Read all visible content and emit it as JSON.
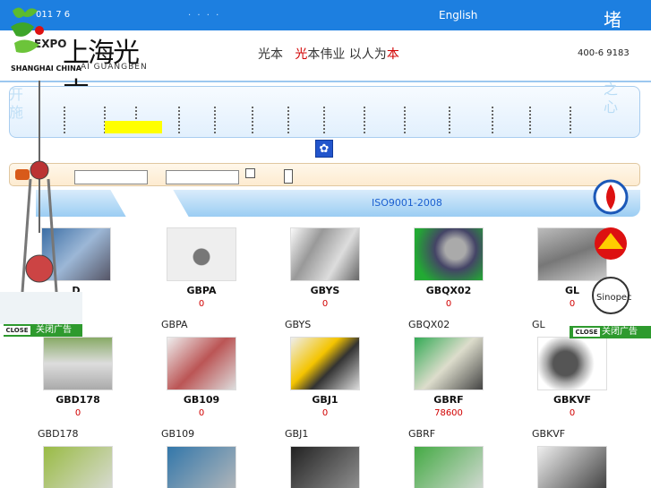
{
  "topbar": {
    "date": "011 7 6",
    "dots": "· · · ·",
    "english": "English",
    "right_char": "堵"
  },
  "header": {
    "logo": {
      "expo": "EXPO",
      "cn": "上海光本",
      "en": "AI GUANGBEN",
      "sh": "SHANGHAI CHINA"
    },
    "slogan_a": "光本",
    "slogan_b": "光",
    "slogan_c": "本伟业  以人为",
    "slogan_d": "本",
    "phone": "400-6  9183"
  },
  "section": {
    "iso": "ISO9001-2008"
  },
  "left_ad": {
    "vertical_text": "开 施",
    "close_btn": "CLOSE",
    "close_label": "关闭广告"
  },
  "right_ad": {
    "vertical_text": "之 心",
    "close_btn": "CLOSE",
    "close_label": "关闭广告"
  },
  "products": [
    {
      "code": "D",
      "price": "",
      "sub": ""
    },
    {
      "code": "GBPA",
      "price": "0",
      "sub": "GBPA"
    },
    {
      "code": "GBYS",
      "price": "0",
      "sub": "GBYS"
    },
    {
      "code": "GBQX02",
      "price": "0",
      "sub": "GBQX02"
    },
    {
      "code": "GL",
      "price": "0",
      "sub": "GL"
    },
    {
      "code": "GBD178",
      "price": "0",
      "sub": "GBD178"
    },
    {
      "code": "GB109",
      "price": "0",
      "sub": "GB109"
    },
    {
      "code": "GBJ1",
      "price": "0",
      "sub": "GBJ1"
    },
    {
      "code": "GBRF",
      "price": "78600",
      "sub": "GBRF"
    },
    {
      "code": "GBKVF",
      "price": "0",
      "sub": "GBKVF"
    }
  ],
  "colors": {
    "brand_blue": "#1d7fe0",
    "price_red": "#d10000",
    "ad_green": "#2e9a2e",
    "highlight": "#ffff00"
  },
  "icons": {
    "paw": "paw-icon",
    "search": "search-icon"
  }
}
